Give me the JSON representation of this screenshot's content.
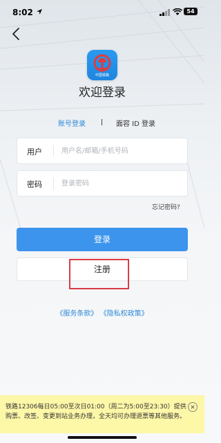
{
  "status_bar": {
    "time": "8:02",
    "battery": "54"
  },
  "app": {
    "logo_label": "中国铁路",
    "welcome_title": "欢迎登录"
  },
  "tabs": {
    "account": "账号登录",
    "face_id": "面容 ID 登录"
  },
  "form": {
    "user_label": "用户",
    "user_placeholder": "用户名/邮箱/手机号码",
    "password_label": "密码",
    "password_placeholder": "登录密码",
    "forgot": "忘记密码?"
  },
  "buttons": {
    "login": "登录",
    "register": "注册"
  },
  "links": {
    "terms": "《服务条款》",
    "privacy": "《隐私权政策》"
  },
  "notice": {
    "text": "铁路12306每日05:00至次日01:00（周二为5:00至23:30）提供购票、改签、变更到站业务办理，全天均可办理退票等其他服务。"
  },
  "colors": {
    "accent": "#3c94ec",
    "link": "#2f8ad8",
    "notice_bg": "#fdf7a8",
    "highlight": "#d93a44"
  },
  "icons": [
    "location-arrow-icon",
    "signal-icon",
    "wifi-icon",
    "battery-icon",
    "back-chevron-icon",
    "railway-logo-icon",
    "close-circle-icon"
  ]
}
